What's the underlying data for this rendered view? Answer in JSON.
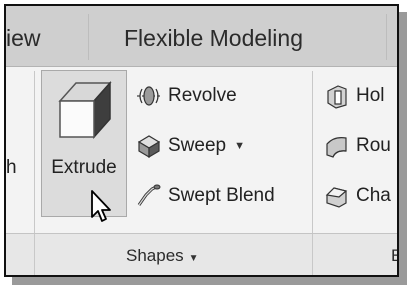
{
  "tabs": [
    {
      "label": "iew"
    },
    {
      "label": "Flexible Modeling"
    }
  ],
  "left_cut": {
    "label": "h"
  },
  "shapes_panel": {
    "extrude": {
      "label": "Extrude",
      "icon": "extrude-cube-icon"
    },
    "items": [
      {
        "label": "Revolve",
        "icon": "revolve-icon"
      },
      {
        "label": "Sweep",
        "icon": "sweep-icon",
        "dropdown": "▼"
      },
      {
        "label": "Swept Blend",
        "icon": "swept-blend-icon"
      }
    ],
    "footer_label": "Shapes",
    "footer_arrow": "▼"
  },
  "engineering_panel": {
    "items": [
      {
        "label": "Hol",
        "icon": "hole-icon"
      },
      {
        "label": "Rou",
        "icon": "round-icon"
      },
      {
        "label": "Cha",
        "icon": "chamfer-icon"
      }
    ],
    "footer_label": "E"
  },
  "colors": {
    "tab_bar": "#cfcfcf",
    "ribbon": "#f3f3f3",
    "extrude_highlight": "#dcdcdc",
    "footer": "#e7e7e7"
  }
}
